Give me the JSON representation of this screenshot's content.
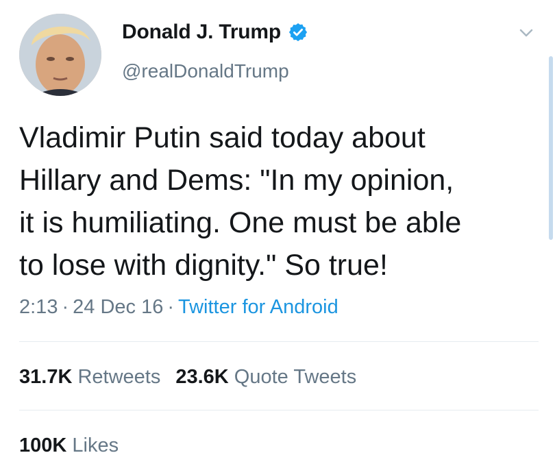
{
  "author": {
    "display_name": "Donald J. Trump",
    "handle": "@realDonaldTrump",
    "verified": true
  },
  "tweet": {
    "text": "Vladimir Putin said today about\nHillary and Dems: \"In my opinion,\nit is humiliating. One must be able\nto lose with dignity.\"  So true!"
  },
  "meta": {
    "time": "2:13",
    "separator": "·",
    "date": "24 Dec 16",
    "source": "Twitter for Android"
  },
  "stats": {
    "retweets_count": "31.7K",
    "retweets_label": "Retweets",
    "quote_count": "23.6K",
    "quote_label": "Quote Tweets",
    "likes_count": "100K",
    "likes_label": "Likes"
  },
  "icons": {
    "verified": "verified-badge-icon",
    "menu": "chevron-down-icon"
  },
  "colors": {
    "accent": "#1b95e0",
    "secondary_text": "#657786",
    "primary_text": "#14171a",
    "divider": "#e6ecf0"
  }
}
